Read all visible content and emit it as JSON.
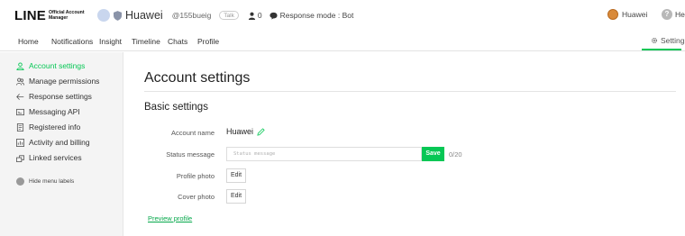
{
  "header": {
    "logo_main": "LINE",
    "logo_sub_1": "Official Account",
    "logo_sub_2": "Manager",
    "account_name": "Huawei",
    "account_id": "@155bueig",
    "account_pill": "Talk",
    "friends_count": "0",
    "response_mode": "Response mode : Bot",
    "user_name": "Huawei",
    "help_label": "Hel"
  },
  "nav": {
    "items": [
      "Home",
      "Notifications",
      "Insight",
      "Timeline",
      "Chats",
      "Profile"
    ],
    "settings_label": "Settings"
  },
  "sidebar": {
    "items": [
      {
        "label": "Account settings",
        "icon": "person-icon"
      },
      {
        "label": "Manage permissions",
        "icon": "people-icon"
      },
      {
        "label": "Response settings",
        "icon": "response-icon"
      },
      {
        "label": "Messaging API",
        "icon": "api-icon"
      },
      {
        "label": "Registered info",
        "icon": "document-icon"
      },
      {
        "label": "Activity and billing",
        "icon": "billing-icon"
      },
      {
        "label": "Linked services",
        "icon": "link-icon"
      }
    ],
    "hide_labels": "Hide menu labels"
  },
  "main": {
    "title": "Account settings",
    "section": "Basic settings",
    "account_name_label": "Account name",
    "account_name_value": "Huawei",
    "status_label": "Status message",
    "status_placeholder": "Status message",
    "save_label": "Save",
    "status_counter": "0/20",
    "profile_photo_label": "Profile photo",
    "cover_photo_label": "Cover photo",
    "edit_label": "Edit",
    "preview_label": "Preview profile"
  },
  "colors": {
    "accent": "#06c755"
  }
}
